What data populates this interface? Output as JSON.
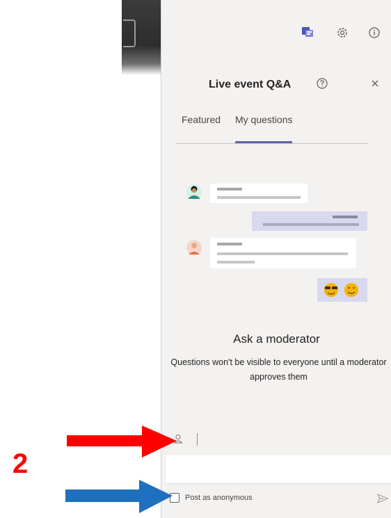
{
  "panel": {
    "title": "Live event Q&A",
    "tabs": [
      "Featured",
      "My questions"
    ],
    "active_tab": "My questions",
    "empty_state": {
      "title": "Ask a moderator",
      "description": "Questions won't be visible to everyone until a moderator approves them"
    },
    "composer": {
      "anonymous_label": "Post as anonymous",
      "anonymous_checked": false
    }
  },
  "annotation": {
    "number": "2",
    "colors": {
      "red_arrow": "#ff0000",
      "blue_arrow": "#1f6fbf"
    }
  },
  "icons": [
    "qna-icon",
    "settings-icon",
    "info-icon",
    "help-icon",
    "close-icon",
    "person-icon",
    "send-icon"
  ],
  "colors": {
    "accent": "#6264a7",
    "panel_bg": "#f3f2f1"
  }
}
